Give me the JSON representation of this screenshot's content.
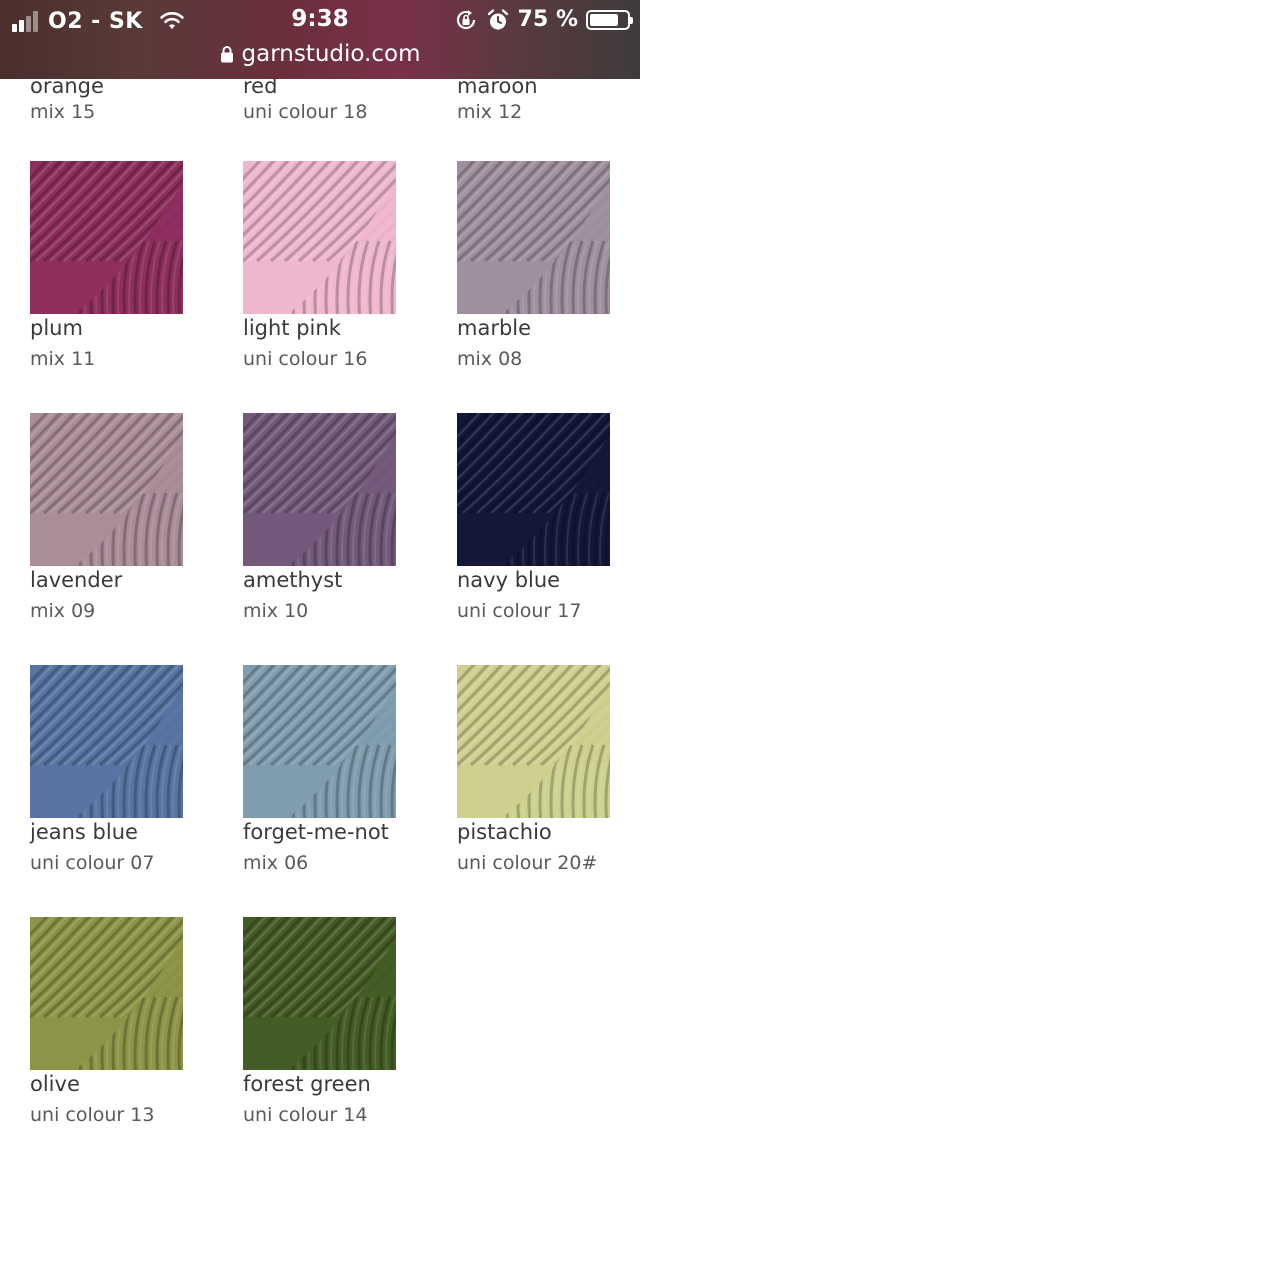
{
  "status_bar": {
    "carrier": "O2 - SK",
    "time": "9:38",
    "battery_percent": "75 %",
    "battery_level": 0.75
  },
  "address_bar": {
    "url": "garnstudio.com"
  },
  "partial_row": [
    {
      "name": "orange",
      "code": "mix 15"
    },
    {
      "name": "red",
      "code": "uni colour 18"
    },
    {
      "name": "maroon",
      "code": "mix 12"
    }
  ],
  "colours": [
    {
      "name": "plum",
      "code": "mix 11",
      "color": "#8e2f5e"
    },
    {
      "name": "light pink",
      "code": "uni colour 16",
      "color": "#efb7ce"
    },
    {
      "name": "marble",
      "code": "mix 08",
      "color": "#a0909e"
    },
    {
      "name": "lavender",
      "code": "mix 09",
      "color": "#a98d99"
    },
    {
      "name": "amethyst",
      "code": "mix 10",
      "color": "#735a7a"
    },
    {
      "name": "navy blue",
      "code": "uni colour 17",
      "color": "#14173a"
    },
    {
      "name": "jeans blue",
      "code": "uni colour 07",
      "color": "#5874a2"
    },
    {
      "name": "forget-me-not",
      "code": "mix 06",
      "color": "#7f9dad"
    },
    {
      "name": "pistachio",
      "code": "uni colour 20#",
      "color": "#cdd08f"
    },
    {
      "name": "olive",
      "code": "uni colour 13",
      "color": "#8d9448"
    },
    {
      "name": "forest green",
      "code": "uni colour 14",
      "color": "#445c25"
    }
  ]
}
